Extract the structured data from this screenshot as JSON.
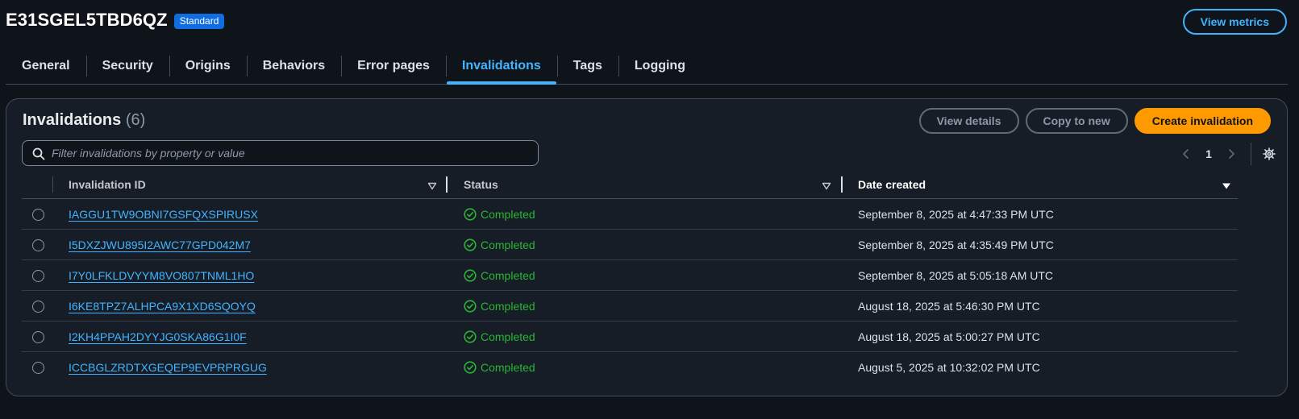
{
  "header": {
    "distribution_id": "E31SGEL5TBD6QZ",
    "badge": "Standard",
    "view_metrics_label": "View metrics"
  },
  "tabs": [
    {
      "label": "General"
    },
    {
      "label": "Security"
    },
    {
      "label": "Origins"
    },
    {
      "label": "Behaviors"
    },
    {
      "label": "Error pages"
    },
    {
      "label": "Invalidations",
      "active": true
    },
    {
      "label": "Tags"
    },
    {
      "label": "Logging"
    }
  ],
  "invalidations": {
    "title": "Invalidations",
    "count": "(6)",
    "view_details_label": "View details",
    "copy_to_new_label": "Copy to new",
    "create_label": "Create invalidation",
    "filter_placeholder": "Filter invalidations by property or value",
    "page": "1",
    "columns": {
      "id": "Invalidation ID",
      "status": "Status",
      "date": "Date created"
    },
    "rows": [
      {
        "id": "IAGGU1TW9OBNI7GSFQXSPIRUSX",
        "status": "Completed",
        "date": "September 8, 2025 at 4:47:33 PM UTC"
      },
      {
        "id": "I5DXZJWU895I2AWC77GPD042M7",
        "status": "Completed",
        "date": "September 8, 2025 at 4:35:49 PM UTC"
      },
      {
        "id": "I7Y0LFKLDVYYM8VO807TNML1HO",
        "status": "Completed",
        "date": "September 8, 2025 at 5:05:18 AM UTC"
      },
      {
        "id": "I6KE8TPZ7ALHPCA9X1XD6SQOYQ",
        "status": "Completed",
        "date": "August 18, 2025 at 5:46:30 PM UTC"
      },
      {
        "id": "I2KH4PPAH2DYYJG0SKA86G1I0F",
        "status": "Completed",
        "date": "August 18, 2025 at 5:00:27 PM UTC"
      },
      {
        "id": "ICCBGLZRDTXGEQEP9EVPRPRGUG",
        "status": "Completed",
        "date": "August 5, 2025 at 10:32:02 PM UTC"
      }
    ]
  },
  "colors": {
    "background": "#0f141a",
    "panel": "#161d26",
    "accent": "#42b4ff",
    "primary": "#ff9900",
    "success": "#2bb534",
    "badge": "#0f6de0"
  }
}
